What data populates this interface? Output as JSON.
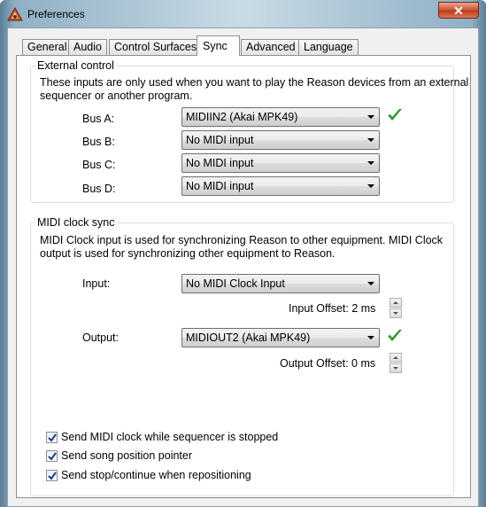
{
  "window": {
    "title": "Preferences",
    "close_glyph": "✕"
  },
  "tabs": [
    {
      "label": "General"
    },
    {
      "label": "Audio"
    },
    {
      "label": "Control Surfaces"
    },
    {
      "label": "Sync",
      "active": true
    },
    {
      "label": "Advanced"
    },
    {
      "label": "Language"
    }
  ],
  "external_control": {
    "title": "External control",
    "description_line1": "These inputs are only used when you want to play the Reason devices from an external",
    "description_line2": "sequencer or another program.",
    "buses": [
      {
        "label": "Bus A:",
        "value": "MIDIIN2 (Akai MPK49)",
        "icon": "green-checkmark-icon"
      },
      {
        "label": "Bus B:",
        "value": "No MIDI input"
      },
      {
        "label": "Bus C:",
        "value": "No MIDI input"
      },
      {
        "label": "Bus D:",
        "value": "No MIDI input"
      }
    ]
  },
  "midi_clock_sync": {
    "title": "MIDI clock sync",
    "description_line1": "MIDI Clock input is used for synchronizing Reason to other equipment. MIDI Clock",
    "description_line2": "output is used for synchronizing other equipment to Reason.",
    "input_label": "Input:",
    "input_value": "No MIDI Clock Input",
    "input_offset": "Input Offset: 2 ms",
    "output_label": "Output:",
    "output_value": "MIDIOUT2 (Akai MPK49)",
    "output_icon": "green-checkmark-icon",
    "output_offset": "Output Offset: 0 ms",
    "options": [
      {
        "label": "Send MIDI clock while sequencer is stopped",
        "checked": true
      },
      {
        "label": "Send song position pointer",
        "checked": true
      },
      {
        "label": "Send stop/continue when repositioning",
        "checked": true
      }
    ]
  },
  "colors": {
    "accent_check": "#2e9a2e",
    "close_red": "#c33a18"
  }
}
